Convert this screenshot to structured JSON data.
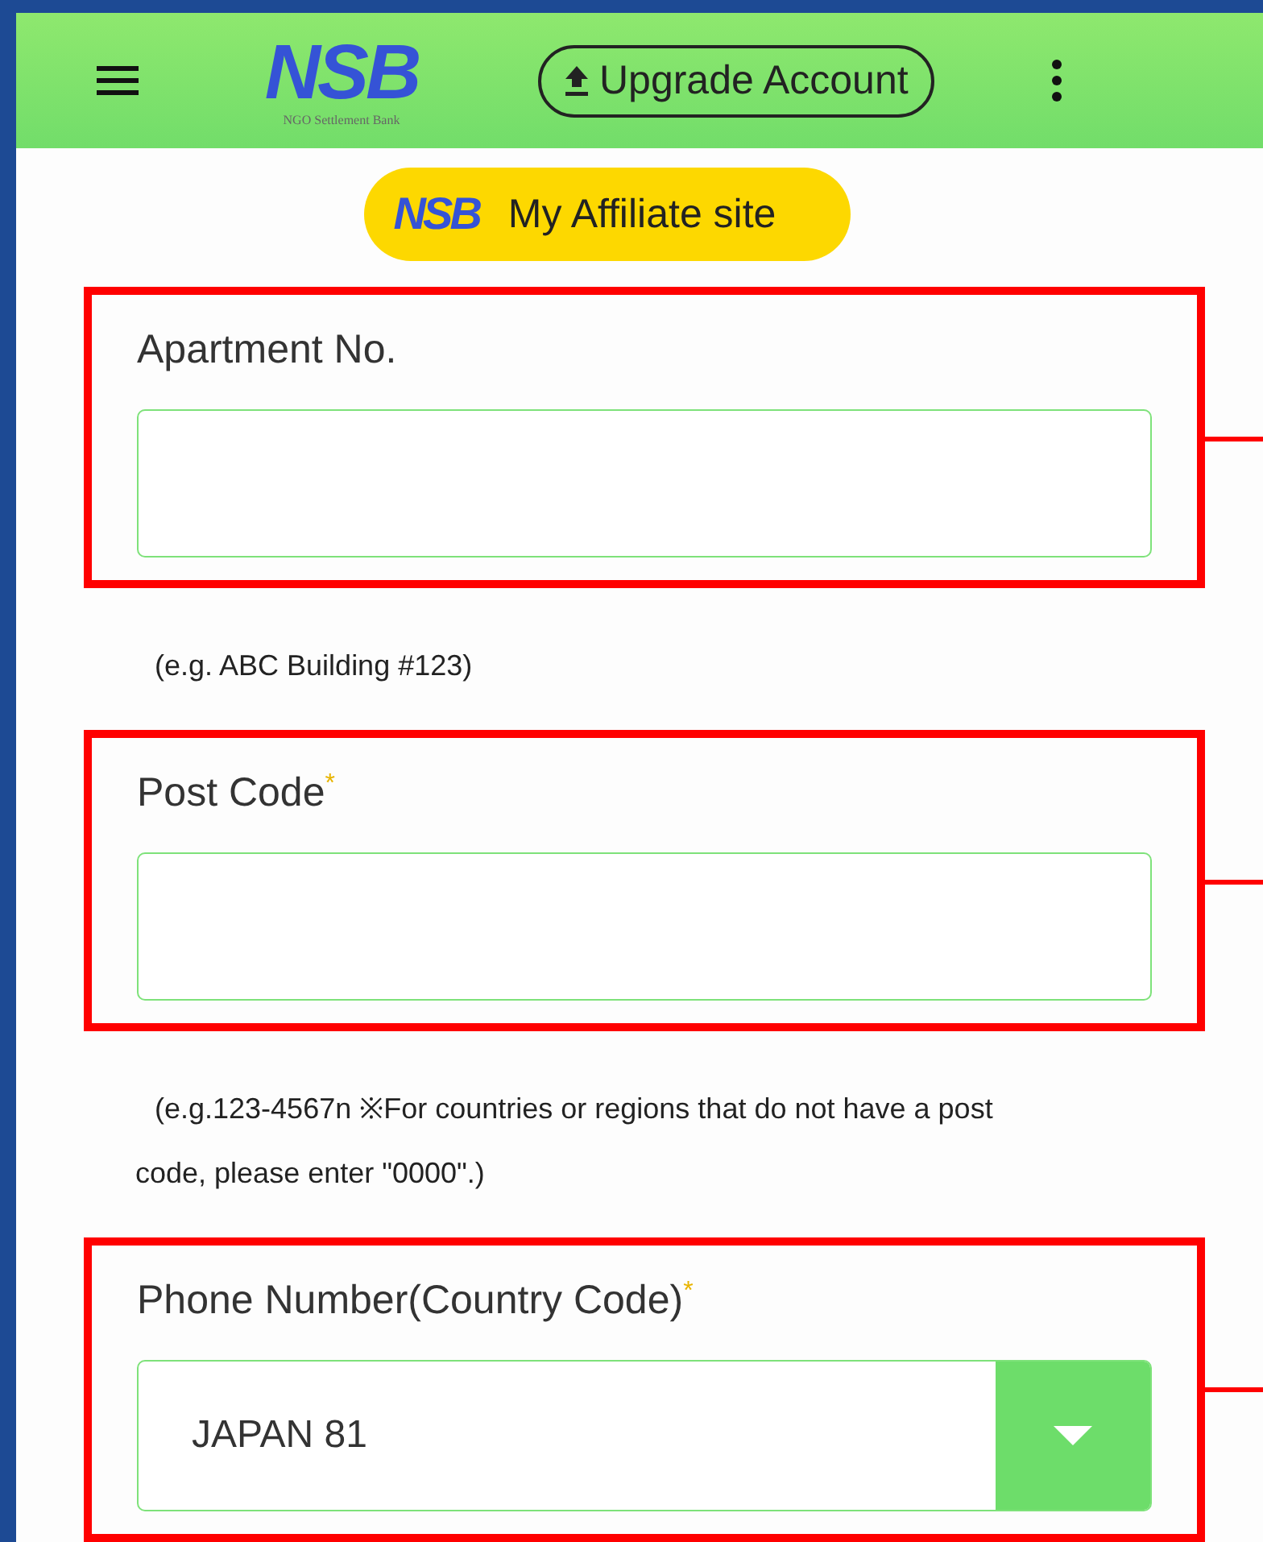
{
  "header": {
    "logo": {
      "letters": "NSB",
      "tagline": "NGO Settlement Bank"
    },
    "upgrade_button": "Upgrade Account"
  },
  "affiliate_button": {
    "logo": "NSB",
    "label": "My Affiliate site"
  },
  "fields": [
    {
      "kind": "text",
      "label": "Apartment No.",
      "highlighted": true,
      "hint": "(e.g. ABC Building #123)"
    },
    {
      "kind": "text",
      "label": "Post Code",
      "required_mark": "*",
      "highlighted": true,
      "hint": "(e.g.123-4567n ※For countries or regions that do not have a post code, please enter \"0000\".)"
    },
    {
      "kind": "select",
      "label": "Phone Number(Country Code)",
      "required_mark": "*",
      "highlighted": true,
      "value": "JAPAN 81"
    }
  ]
}
